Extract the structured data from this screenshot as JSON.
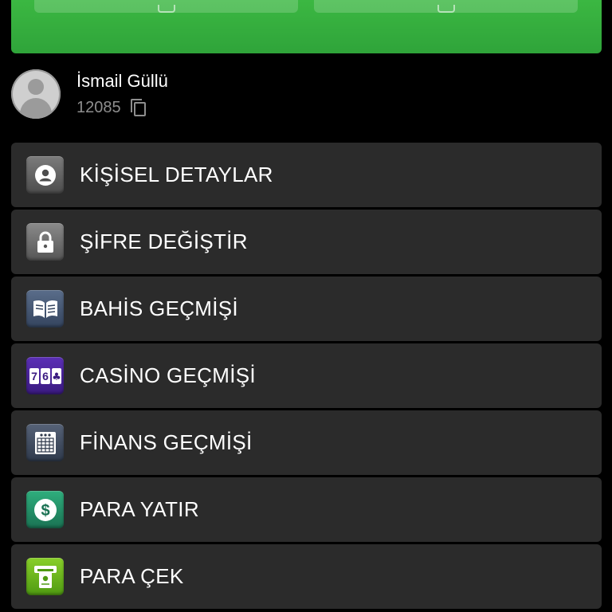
{
  "user": {
    "name": "İsmail Güllü",
    "id": "12085"
  },
  "menu": {
    "items": [
      {
        "label": "KİŞİSEL DETAYLAR",
        "icon": "user-icon"
      },
      {
        "label": "ŞİFRE DEĞİŞTİR",
        "icon": "lock-icon"
      },
      {
        "label": "BAHİS GEÇMİŞİ",
        "icon": "book-icon"
      },
      {
        "label": "CASİNO GEÇMİŞİ",
        "icon": "slot-machine-icon"
      },
      {
        "label": "FİNANS GEÇMİŞİ",
        "icon": "calculator-icon"
      },
      {
        "label": "PARA YATIR",
        "icon": "dollar-icon"
      },
      {
        "label": "PARA ÇEK",
        "icon": "atm-icon"
      }
    ]
  },
  "slot_icon_text": {
    "reel1": "7",
    "reel2": "6",
    "reel3": "♣"
  },
  "dollar_icon_text": "$",
  "colors": {
    "background": "#000000",
    "menu_item_bg": "#2b2b2b",
    "top_card_green": "#35ad3c",
    "text_primary": "#ffffff",
    "text_secondary": "#8e8e8e"
  }
}
